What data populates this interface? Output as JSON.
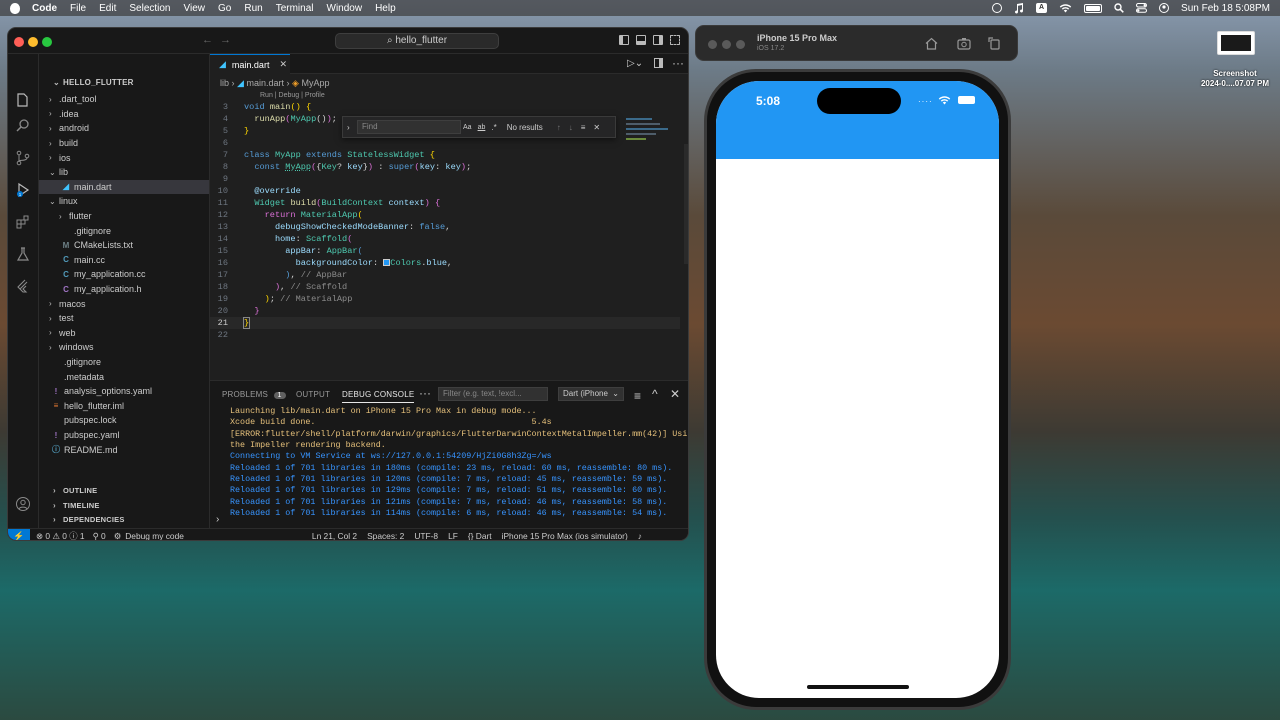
{
  "menubar": {
    "items": [
      "Code",
      "File",
      "Edit",
      "Selection",
      "View",
      "Go",
      "Run",
      "Terminal",
      "Window",
      "Help"
    ],
    "datetime": "Sun Feb 18  5:08PM",
    "input_source": "A"
  },
  "vscode": {
    "search_title": "hello_flutter",
    "sidebar": {
      "title": "HELLO_FLUTTER",
      "tree": [
        {
          "label": ".dart_tool",
          "type": "folder",
          "depth": 1
        },
        {
          "label": ".idea",
          "type": "folder",
          "depth": 1
        },
        {
          "label": "android",
          "type": "folder",
          "depth": 1
        },
        {
          "label": "build",
          "type": "folder",
          "depth": 1
        },
        {
          "label": "ios",
          "type": "folder",
          "depth": 1
        },
        {
          "label": "lib",
          "type": "folder-open",
          "depth": 1
        },
        {
          "label": "main.dart",
          "type": "dart",
          "depth": 2,
          "active": true
        },
        {
          "label": "linux",
          "type": "folder-open",
          "depth": 1
        },
        {
          "label": "flutter",
          "type": "folder",
          "depth": 2
        },
        {
          "label": ".gitignore",
          "type": "file",
          "depth": 2
        },
        {
          "label": "CMakeLists.txt",
          "type": "cmake",
          "depth": 2
        },
        {
          "label": "main.cc",
          "type": "cc",
          "depth": 2
        },
        {
          "label": "my_application.cc",
          "type": "cc",
          "depth": 2
        },
        {
          "label": "my_application.h",
          "type": "h",
          "depth": 2
        },
        {
          "label": "macos",
          "type": "folder",
          "depth": 1
        },
        {
          "label": "test",
          "type": "folder",
          "depth": 1
        },
        {
          "label": "web",
          "type": "folder",
          "depth": 1
        },
        {
          "label": "windows",
          "type": "folder",
          "depth": 1
        },
        {
          "label": ".gitignore",
          "type": "file",
          "depth": 1
        },
        {
          "label": ".metadata",
          "type": "file",
          "depth": 1
        },
        {
          "label": "analysis_options.yaml",
          "type": "yaml",
          "depth": 1
        },
        {
          "label": "hello_flutter.iml",
          "type": "iml",
          "depth": 1
        },
        {
          "label": "pubspec.lock",
          "type": "file",
          "depth": 1
        },
        {
          "label": "pubspec.yaml",
          "type": "yaml",
          "depth": 1
        },
        {
          "label": "README.md",
          "type": "md",
          "depth": 1
        }
      ],
      "sections": [
        "OUTLINE",
        "TIMELINE",
        "DEPENDENCIES"
      ]
    },
    "editor": {
      "tab_label": "main.dart",
      "breadcrumb": [
        "lib",
        "main.dart",
        "MyApp"
      ],
      "codelens": "Run | Debug | Profile",
      "find": {
        "placeholder": "Find",
        "result": "No results"
      }
    },
    "panel": {
      "tabs": [
        "PROBLEMS",
        "OUTPUT",
        "DEBUG CONSOLE"
      ],
      "problems_count": "1",
      "filter_placeholder": "Filter (e.g. text, !excl...",
      "session": "Dart (iPhone",
      "console_lines": [
        "Launching lib/main.dart on iPhone 15 Pro Max in debug mode...",
        "Xcode build done.                                           5.4s",
        "[ERROR:flutter/shell/platform/darwin/graphics/FlutterDarwinContextMetalImpeller.mm(42)] Using",
        "the Impeller rendering backend.",
        "Connecting to VM Service at ws://127.0.0.1:54209/HjZi0G8h3Zg=/ws",
        "Reloaded 1 of 701 libraries in 180ms (compile: 23 ms, reload: 60 ms, reassemble: 80 ms).",
        "Reloaded 1 of 701 libraries in 120ms (compile: 7 ms, reload: 45 ms, reassemble: 59 ms).",
        "Reloaded 1 of 701 libraries in 129ms (compile: 7 ms, reload: 51 ms, reassemble: 60 ms).",
        "Reloaded 1 of 701 libraries in 121ms (compile: 7 ms, reload: 46 ms, reassemble: 58 ms).",
        "Reloaded 1 of 701 libraries in 114ms (compile: 6 ms, reload: 46 ms, reassemble: 54 ms)."
      ]
    },
    "status": {
      "errors": "0",
      "warnings": "0",
      "info": "1",
      "ports": "0",
      "debug": "Debug my code",
      "position": "Ln 21, Col 2",
      "spaces": "Spaces: 2",
      "encoding": "UTF-8",
      "eol": "LF",
      "language": "Dart",
      "device": "iPhone 15 Pro Max (ios simulator)"
    }
  },
  "simulator": {
    "device": "iPhone 15 Pro Max",
    "os": "iOS 17.2",
    "time": "5:08",
    "appbar_color": "#2196f3"
  },
  "screenshot_thumb": {
    "title": "Screenshot",
    "subtitle": "2024-0....07.07 PM"
  }
}
